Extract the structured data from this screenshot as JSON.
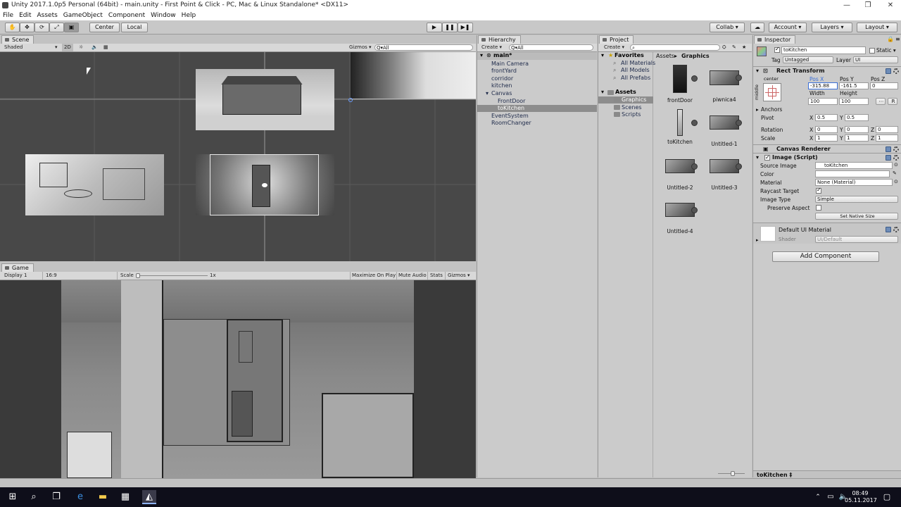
{
  "window": {
    "title": "Unity 2017.1.0p5 Personal (64bit) - main.unity - First Point & Click - PC, Mac & Linux Standalone* <DX11>",
    "minimize": "—",
    "maximize": "❐",
    "close": "✕"
  },
  "menu": [
    "File",
    "Edit",
    "Assets",
    "GameObject",
    "Component",
    "Window",
    "Help"
  ],
  "toolbar": {
    "tools": [
      "hand-icon",
      "move-icon",
      "rotate-icon",
      "scale-icon",
      "rect-icon"
    ],
    "center": "Center",
    "local": "Local",
    "play": "▶",
    "pause": "❚❚",
    "step": "▶❚",
    "collab": "Collab ▾",
    "account": "Account",
    "layers": "Layers",
    "layout": "Layout"
  },
  "scene": {
    "tab": "Scene",
    "shading": "Shaded",
    "mode2d": "2D",
    "gizmos": "Gizmos ▾",
    "search_placeholder": "Q▾All"
  },
  "game": {
    "tab": "Game",
    "display": "Display 1",
    "aspect": "16:9",
    "scale_label": "Scale",
    "scale_value": "1x",
    "maximize": "Maximize On Play",
    "mute": "Mute Audio",
    "stats": "Stats",
    "gizmos": "Gizmos ▾"
  },
  "hierarchy": {
    "tab": "Hierarchy",
    "create": "Create ▾",
    "search_placeholder": "Q▾All",
    "scene_name": "main*",
    "items": [
      "Main Camera",
      "frontYard",
      "corridor",
      "kitchen",
      "Canvas",
      "FrontDoor",
      "toKitchen",
      "EventSystem",
      "RoomChanger"
    ]
  },
  "project": {
    "tab": "Project",
    "create": "Create ▾",
    "favorites_label": "Favorites",
    "favorites": [
      "All Materials",
      "All Models",
      "All Prefabs"
    ],
    "assets_label": "Assets",
    "folders": [
      "Graphics",
      "Scenes",
      "Scripts"
    ],
    "breadcrumb_root": "Assets",
    "breadcrumb_sep": "▸",
    "breadcrumb_leaf": "Graphics",
    "assets": [
      "frontDoor",
      "piwnica4",
      "toKitchen",
      "Untitled-1",
      "Untitled-2",
      "Untitled-3",
      "Untitled-4"
    ]
  },
  "inspector": {
    "tab": "Inspector",
    "object_name": "toKitchen",
    "static": "Static ▾",
    "tag_label": "Tag",
    "tag_value": "Untagged",
    "layer_label": "Layer",
    "layer_value": "UI",
    "rect_transform": "Rect Transform",
    "anchor_h": "center",
    "anchor_v": "middle",
    "pos_x_label": "Pos X",
    "pos_y_label": "Pos Y",
    "pos_z_label": "Pos Z",
    "pos_x": "-315.88",
    "pos_y": "-161.5",
    "pos_z": "0",
    "width_label": "Width",
    "height_label": "Height",
    "width": "100",
    "height": "100",
    "raw_button": "R",
    "anchors": "Anchors",
    "pivot_label": "Pivot",
    "pivot_x": "0.5",
    "pivot_y": "0.5",
    "rotation_label": "Rotation",
    "rot_x": "0",
    "rot_y": "0",
    "rot_z": "0",
    "scale_label": "Scale",
    "scale_x": "1",
    "scale_y": "1",
    "scale_z": "1",
    "x": "X",
    "y": "Y",
    "z": "Z",
    "canvas_renderer": "Canvas Renderer",
    "image_script": "Image (Script)",
    "source_image_label": "Source Image",
    "source_image": "toKitchen",
    "color_label": "Color",
    "material_label": "Material",
    "material_value": "None (Material)",
    "raycast_label": "Raycast Target",
    "image_type_label": "Image Type",
    "image_type": "Simple",
    "preserve_label": "Preserve Aspect",
    "native_size": "Set Native Size",
    "material_name": "Default UI Material",
    "shader_label": "Shader",
    "shader_value": "UI/Default",
    "add_component": "Add Component",
    "bottom_label": "toKitchen ‡"
  },
  "taskbar": {
    "time": "08:49",
    "date": "05.11.2017"
  }
}
